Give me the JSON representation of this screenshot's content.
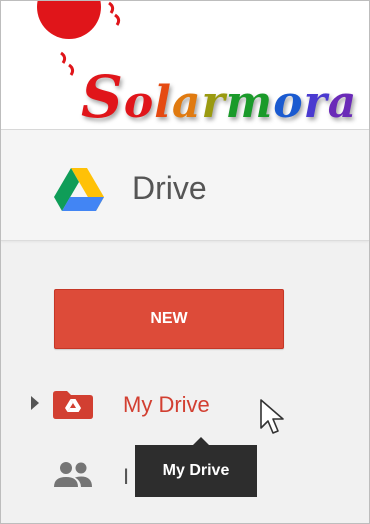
{
  "logo": {
    "letters": [
      "S",
      "o",
      "l",
      "a",
      "r",
      "m",
      "o",
      "r",
      "a"
    ],
    "colors": [
      "#e0151a",
      "#e0151a",
      "#e54a12",
      "#e07a10",
      "#9a9a10",
      "#1a9a2a",
      "#1a5ad0",
      "#4a3ad0",
      "#6a2ab8"
    ]
  },
  "header": {
    "app_title": "Drive",
    "logo_icon": "google-drive-icon"
  },
  "sidebar": {
    "new_button_label": "NEW",
    "items": [
      {
        "label": "My Drive",
        "icon": "my-drive-folder-icon",
        "active": true,
        "expandable": true
      },
      {
        "label": "I",
        "icon": "shared-people-icon",
        "active": false,
        "expandable": false
      }
    ]
  },
  "tooltip": {
    "text": "My Drive"
  },
  "colors": {
    "accent_red": "#dd4b39",
    "active_label": "#d23f31",
    "tooltip_bg": "#2d2d2d",
    "sidebar_bg": "#f1f1f1"
  }
}
